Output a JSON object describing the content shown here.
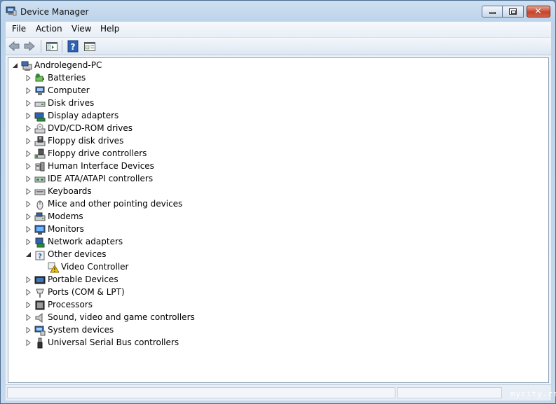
{
  "window": {
    "title": "Device Manager"
  },
  "menu": [
    "File",
    "Action",
    "View",
    "Help"
  ],
  "toolbar": {
    "buttons": [
      "back-arrow-icon",
      "forward-arrow-icon",
      "show-hide-console-tree-icon",
      "help-icon",
      "properties-icon"
    ]
  },
  "tree": {
    "root": {
      "label": "Androlegend-PC",
      "icon": "computer-icon",
      "expanded": true
    },
    "categories": [
      {
        "label": "Batteries",
        "icon": "battery-icon",
        "expanded": false
      },
      {
        "label": "Computer",
        "icon": "computer-icon",
        "expanded": false
      },
      {
        "label": "Disk drives",
        "icon": "disk-drive-icon",
        "expanded": false
      },
      {
        "label": "Display adapters",
        "icon": "display-adapter-icon",
        "expanded": false
      },
      {
        "label": "DVD/CD-ROM drives",
        "icon": "dvd-drive-icon",
        "expanded": false
      },
      {
        "label": "Floppy disk drives",
        "icon": "floppy-disk-icon",
        "expanded": false
      },
      {
        "label": "Floppy drive controllers",
        "icon": "floppy-controller-icon",
        "expanded": false
      },
      {
        "label": "Human Interface Devices",
        "icon": "hid-icon",
        "expanded": false
      },
      {
        "label": "IDE ATA/ATAPI controllers",
        "icon": "ide-controller-icon",
        "expanded": false
      },
      {
        "label": "Keyboards",
        "icon": "keyboard-icon",
        "expanded": false
      },
      {
        "label": "Mice and other pointing devices",
        "icon": "mouse-icon",
        "expanded": false
      },
      {
        "label": "Modems",
        "icon": "modem-icon",
        "expanded": false
      },
      {
        "label": "Monitors",
        "icon": "monitor-icon",
        "expanded": false
      },
      {
        "label": "Network adapters",
        "icon": "network-adapter-icon",
        "expanded": false
      },
      {
        "label": "Other devices",
        "icon": "unknown-device-icon",
        "expanded": true,
        "children": [
          {
            "label": "Video Controller",
            "icon": "warning-device-icon"
          }
        ]
      },
      {
        "label": "Portable Devices",
        "icon": "portable-device-icon",
        "expanded": false
      },
      {
        "label": "Ports (COM & LPT)",
        "icon": "port-icon",
        "expanded": false
      },
      {
        "label": "Processors",
        "icon": "processor-icon",
        "expanded": false
      },
      {
        "label": "Sound, video and game controllers",
        "icon": "speaker-icon",
        "expanded": false
      },
      {
        "label": "System devices",
        "icon": "system-device-icon",
        "expanded": false
      },
      {
        "label": "Universal Serial Bus controllers",
        "icon": "usb-icon",
        "expanded": false
      }
    ]
  },
  "watermark": "mycity.rs",
  "colors": {
    "accent": "#1f5fa8",
    "warning": "#f2c40f",
    "close": "#c7432b"
  }
}
